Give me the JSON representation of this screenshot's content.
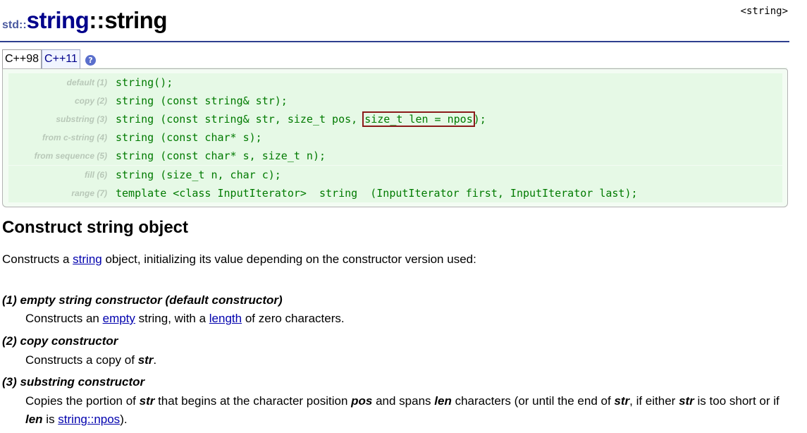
{
  "header": {
    "namespace": "std::",
    "class_name": "string",
    "separator": "::",
    "function_name": "string",
    "include": "<string>"
  },
  "tabs": [
    {
      "label": "C++98",
      "active": true
    },
    {
      "label": "C++11",
      "active": false
    }
  ],
  "help_icon": "?",
  "prototypes": [
    {
      "label": "default (1)",
      "code": "string();"
    },
    {
      "label": "copy (2)",
      "code": "string (const string& str);"
    },
    {
      "label": "substring (3)",
      "code_before": "string (const string& str, size_t pos, ",
      "code_highlight": "size_t len = npos",
      "code_after": ");"
    },
    {
      "label": "from c-string (4)",
      "code": "string (const char* s);"
    },
    {
      "label": "from sequence (5)",
      "code": "string (const char* s, size_t n);"
    },
    {
      "label": "fill (6)",
      "code": "string (size_t n, char c);"
    },
    {
      "label": "range (7)",
      "code": "template <class InputIterator>  string  (InputIterator first, InputIterator last);"
    }
  ],
  "section_title": "Construct string object",
  "intro": {
    "before": "Constructs a ",
    "link": "string",
    "after": " object, initializing its value depending on the constructor version used:"
  },
  "items": {
    "empty": {
      "term": "(1) empty string constructor (default constructor)",
      "d_before": "Constructs an ",
      "d_link1": "empty",
      "d_mid": " string, with a ",
      "d_link2": "length",
      "d_after": " of zero characters."
    },
    "copy": {
      "term": "(2) copy constructor",
      "d_before": "Constructs a copy of ",
      "d_bold": "str",
      "d_after": "."
    },
    "substring": {
      "term": "(3) substring constructor",
      "t1": "Copies the portion of ",
      "b1": "str",
      "t2": " that begins at the character position ",
      "b2": "pos",
      "t3": " and spans ",
      "b3": "len",
      "t4": " characters (or until the end of ",
      "b4": "str",
      "t5": ", if either ",
      "b5": "str",
      "t6": " is too short or if ",
      "b6": "len",
      "t7": " is ",
      "link": "string::npos",
      "t8": ")."
    }
  }
}
